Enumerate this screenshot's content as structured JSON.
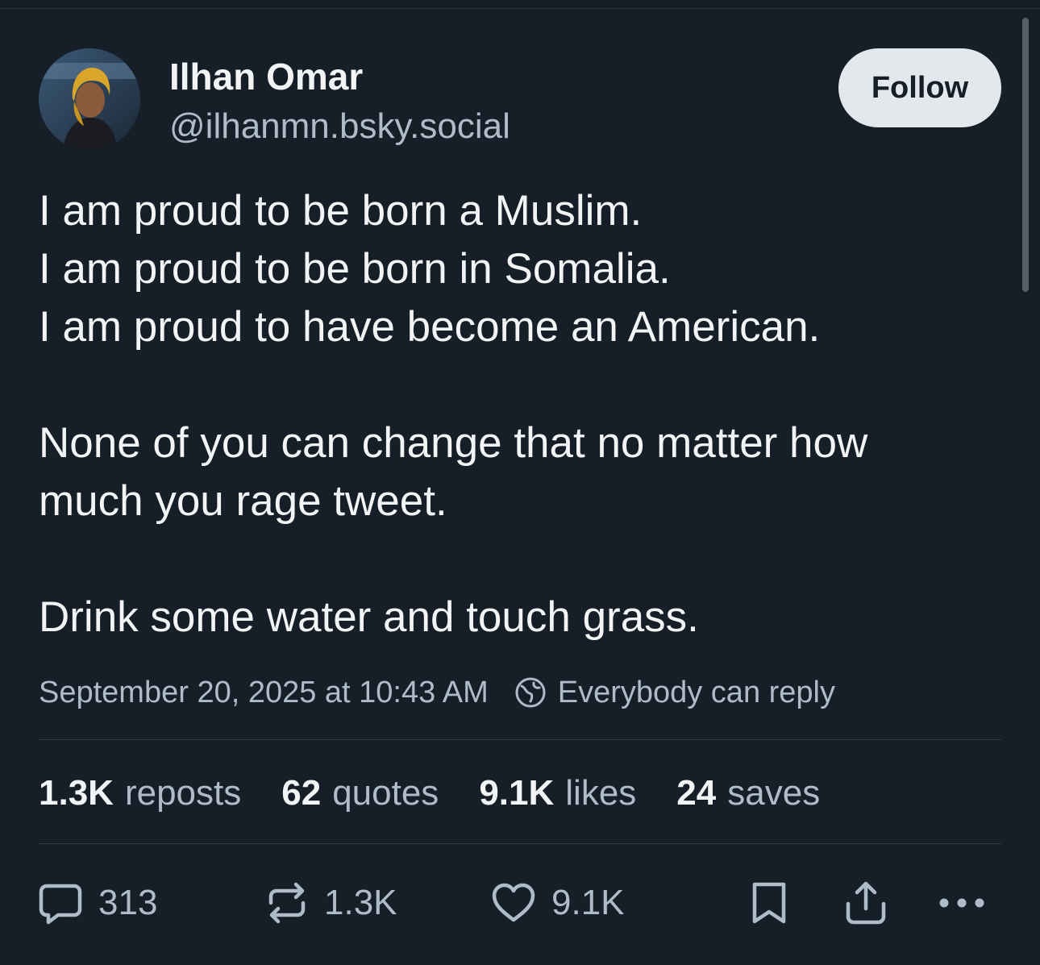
{
  "author": {
    "display_name": "Ilhan Omar",
    "handle": "@ilhanmn.bsky.social"
  },
  "follow_button_label": "Follow",
  "post": {
    "lines": [
      "I am proud to be born a Muslim.",
      "I am proud to be born in Somalia.",
      "I am proud to have become an American.",
      "",
      "None of you can change that no matter how",
      "much you rage tweet.",
      "",
      "Drink some water and touch grass."
    ],
    "timestamp": "September 20, 2025 at 10:43 AM",
    "reply_setting": "Everybody can reply"
  },
  "stats": {
    "reposts": {
      "count": "1.3K",
      "label": "reposts"
    },
    "quotes": {
      "count": "62",
      "label": "quotes"
    },
    "likes": {
      "count": "9.1K",
      "label": "likes"
    },
    "saves": {
      "count": "24",
      "label": "saves"
    }
  },
  "actions": {
    "reply_count": "313",
    "repost_count": "1.3K",
    "like_count": "9.1K"
  },
  "icons": {
    "reply": "speech-bubble-icon",
    "repost": "repost-arrows-icon",
    "like": "heart-icon",
    "save": "bookmark-icon",
    "share": "share-upload-icon",
    "more": "ellipsis-icon",
    "reply_setting": "globe-icon"
  },
  "colors": {
    "background": "#161e27",
    "text_primary": "#f1f3f5",
    "text_secondary": "#aebbc9",
    "follow_button_bg": "#e3e8ed"
  }
}
